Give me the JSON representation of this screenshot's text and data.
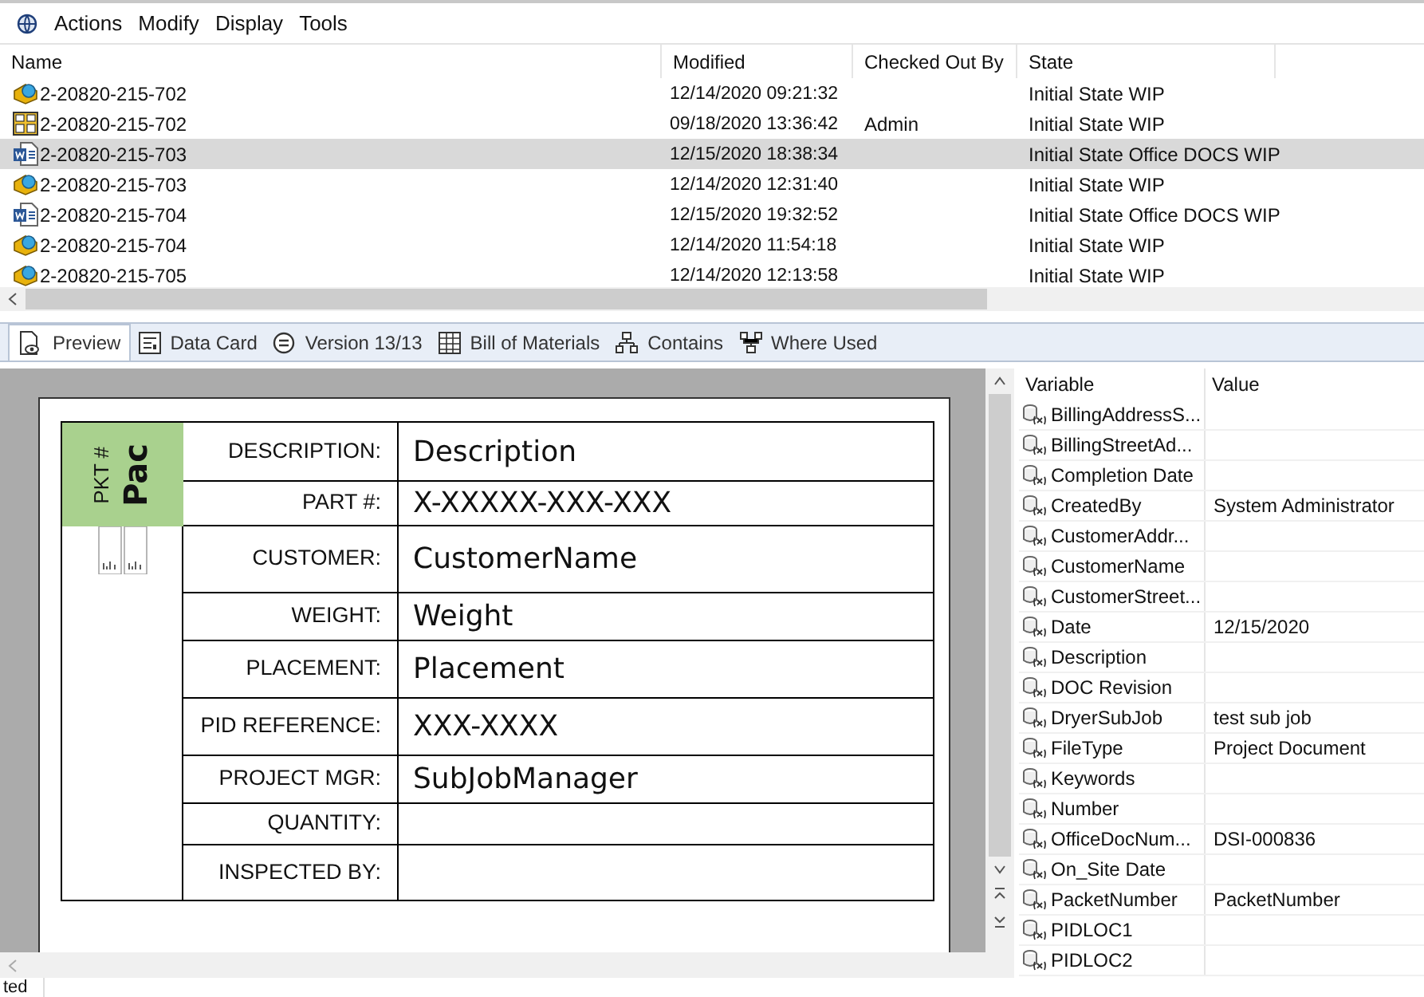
{
  "menu": [
    "Actions",
    "Modify",
    "Display",
    "Tools"
  ],
  "table": {
    "columns": [
      "Name",
      "Modified",
      "Checked Out By",
      "State"
    ],
    "rows": [
      {
        "kind": "part",
        "name": "2-20820-215-702",
        "modified": "12/14/2020 09:21:32",
        "state": "Initial State WIP",
        "selected": false
      },
      {
        "kind": "drawing",
        "name": "2-20820-215-702",
        "modified": "09/18/2020 13:36:42",
        "checked_out_by": "Admin",
        "state": "Initial State WIP",
        "selected": false
      },
      {
        "kind": "doc",
        "name": "2-20820-215-703",
        "modified": "12/15/2020 18:38:34",
        "state": "Initial State Office DOCS WIP",
        "selected": true
      },
      {
        "kind": "part",
        "name": "2-20820-215-703",
        "modified": "12/14/2020 12:31:40",
        "state": "Initial State WIP",
        "selected": false
      },
      {
        "kind": "doc",
        "name": "2-20820-215-704",
        "modified": "12/15/2020 19:32:52",
        "state": "Initial State Office DOCS WIP",
        "selected": false
      },
      {
        "kind": "part",
        "name": "2-20820-215-704",
        "modified": "12/14/2020 11:54:18",
        "state": "Initial State WIP",
        "selected": false
      },
      {
        "kind": "part",
        "name": "2-20820-215-705",
        "modified": "12/14/2020 12:13:58",
        "state": "Initial State WIP",
        "selected": false
      }
    ]
  },
  "tabs": [
    {
      "kind": "preview",
      "label": "Preview",
      "selected": true
    },
    {
      "kind": "datacard",
      "label": "Data Card",
      "selected": false
    },
    {
      "kind": "version",
      "label": "Version 13/13",
      "selected": false
    },
    {
      "kind": "bom",
      "label": "Bill of Materials",
      "selected": false
    },
    {
      "kind": "contains",
      "label": "Contains",
      "selected": false
    },
    {
      "kind": "whereused",
      "label": "Where Used",
      "selected": false
    }
  ],
  "preview": {
    "tag_label": "PKT #",
    "tag_value": "Pac",
    "fields": [
      {
        "label": "DESCRIPTION:",
        "value": "Description"
      },
      {
        "label": "PART #:",
        "value": "X-XXXXX-XXX-XXX"
      },
      {
        "label": "CUSTOMER:",
        "value": "CustomerName"
      },
      {
        "label": "WEIGHT:",
        "value": "Weight"
      },
      {
        "label": "PLACEMENT:",
        "value": "Placement"
      },
      {
        "label": "PID REFERENCE:",
        "value": "XXX-XXXX"
      },
      {
        "label": "PROJECT MGR:",
        "value": "SubJobManager"
      },
      {
        "label": "QUANTITY:"
      },
      {
        "label": "INSPECTED BY:"
      }
    ]
  },
  "variables": {
    "columns": [
      "Variable",
      "Value"
    ],
    "rows": [
      {
        "variable": "BillingAddressS..."
      },
      {
        "variable": "BillingStreetAd..."
      },
      {
        "variable": "Completion Date"
      },
      {
        "variable": "CreatedBy",
        "value": "System Administrator"
      },
      {
        "variable": "CustomerAddr..."
      },
      {
        "variable": "CustomerName"
      },
      {
        "variable": "CustomerStreet..."
      },
      {
        "variable": "Date",
        "value": "12/15/2020"
      },
      {
        "variable": "Description"
      },
      {
        "variable": "DOC Revision"
      },
      {
        "variable": "DryerSubJob",
        "value": "test sub job"
      },
      {
        "variable": "FileType",
        "value": "Project Document"
      },
      {
        "variable": "Keywords"
      },
      {
        "variable": "Number"
      },
      {
        "variable": "OfficeDocNum...",
        "value": "DSI-000836"
      },
      {
        "variable": "On_Site Date"
      },
      {
        "variable": "PacketNumber",
        "value": "PacketNumber"
      },
      {
        "variable": "PIDLOC1"
      },
      {
        "variable": "PIDLOC2"
      }
    ]
  },
  "status_bar": "ted"
}
